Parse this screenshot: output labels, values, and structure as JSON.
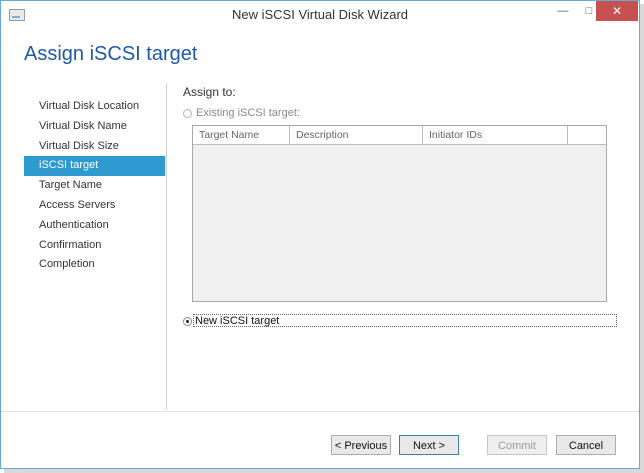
{
  "window": {
    "title": "New iSCSI Virtual Disk Wizard",
    "minimize_glyph": "—",
    "maximize_glyph": "□",
    "close_glyph": "✕"
  },
  "page": {
    "heading": "Assign iSCSI target"
  },
  "nav": {
    "items": [
      {
        "label": "Virtual Disk Location",
        "active": false
      },
      {
        "label": "Virtual Disk Name",
        "active": false
      },
      {
        "label": "Virtual Disk Size",
        "active": false
      },
      {
        "label": "iSCSI target",
        "active": true
      },
      {
        "label": "Target Name",
        "active": false
      },
      {
        "label": "Access Servers",
        "active": false
      },
      {
        "label": "Authentication",
        "active": false
      },
      {
        "label": "Confirmation",
        "active": false
      },
      {
        "label": "Completion",
        "active": false
      }
    ]
  },
  "assign": {
    "label": "Assign to:",
    "existing_label": "Existing iSCSI target:",
    "new_label": "New iSCSI target",
    "selected": "new"
  },
  "table": {
    "columns": [
      "Target Name",
      "Description",
      "Initiator IDs",
      ""
    ],
    "rows": []
  },
  "buttons": {
    "previous": "< Previous",
    "next": "Next >",
    "commit": "Commit",
    "cancel": "Cancel"
  },
  "colors": {
    "accent": "#2e9bd0",
    "heading": "#1d5aa6",
    "close_button": "#c75050"
  }
}
